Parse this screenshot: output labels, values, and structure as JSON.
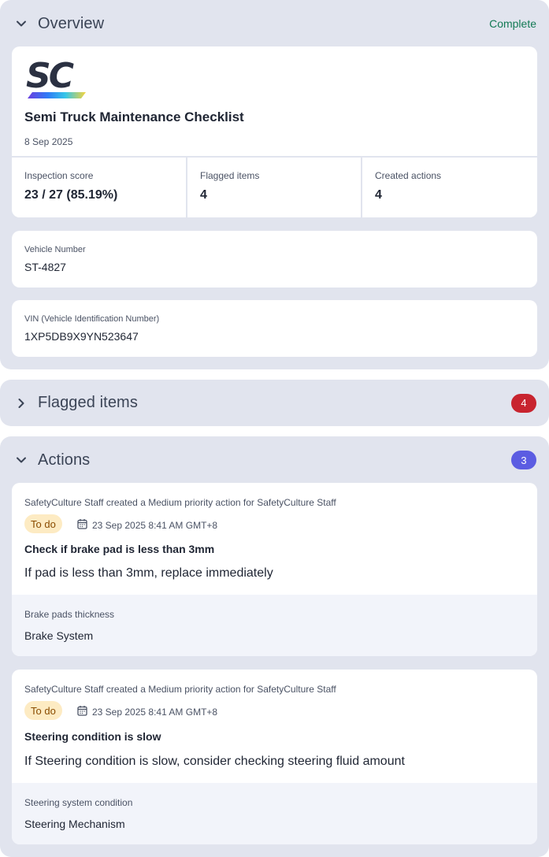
{
  "overview": {
    "title": "Overview",
    "status": "Complete",
    "status_color": "#137a55",
    "doc": {
      "logo": "SC",
      "title": "Semi Truck Maintenance Checklist",
      "date": "8 Sep 2025"
    },
    "stats": [
      {
        "label": "Inspection score",
        "value": "23 / 27 (85.19%)"
      },
      {
        "label": "Flagged items",
        "value": "4"
      },
      {
        "label": "Created actions",
        "value": "4"
      }
    ],
    "fields": [
      {
        "label": "Vehicle Number",
        "value": "ST-4827"
      },
      {
        "label": "VIN (Vehicle Identification Number)",
        "value": "1XP5DB9X9YN523647"
      }
    ]
  },
  "flagged": {
    "title": "Flagged items",
    "count": "4",
    "badge_color": "#c8242f"
  },
  "actions": {
    "title": "Actions",
    "count": "3",
    "badge_color": "#5b5ce2",
    "items": [
      {
        "meta": "SafetyCulture Staff created a Medium priority action for SafetyCulture Staff",
        "status": "To do",
        "due": "23 Sep 2025 8:41 AM GMT+8",
        "title": "Check if brake pad is less than 3mm",
        "description": "If pad is less than 3mm, replace immediately",
        "question": "Brake pads thickness",
        "section": "Brake System"
      },
      {
        "meta": "SafetyCulture Staff created a Medium priority action for SafetyCulture Staff",
        "status": "To do",
        "due": "23 Sep 2025 8:41 AM GMT+8",
        "title": "Steering condition is slow",
        "description": "If Steering condition is slow, consider checking steering fluid amount",
        "question": "Steering system condition",
        "section": "Steering Mechanism"
      }
    ]
  },
  "icons": {
    "collapse": "chevron-down-icon",
    "expand": "chevron-right-icon",
    "due": "calendar-icon"
  }
}
